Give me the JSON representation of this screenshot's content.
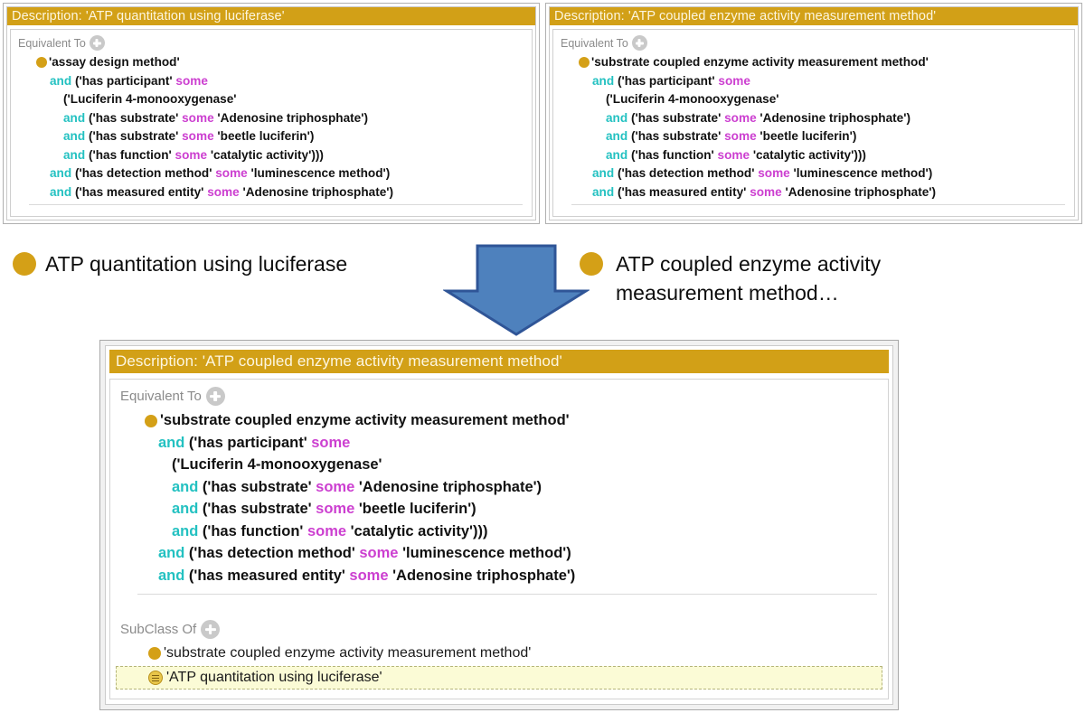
{
  "meta": {
    "colors": {
      "title_bar": "#d2a017",
      "and_keyword": "#23c1c1",
      "some_keyword": "#cc3fd0",
      "class_bullet": "#d4a017",
      "arrow_fill": "#4e81bd",
      "arrow_stroke": "#2f5597",
      "selection_background": "#fbfbd6"
    }
  },
  "panel_left": {
    "title": "Description: 'ATP quantitation using luciferase'",
    "section_label": "Equivalent To",
    "add_icon": "plus-icon",
    "root_class": "'assay design method'",
    "expression_lines": [
      {
        "indent": 0,
        "tokens": [
          {
            "t": "class",
            "v": "'assay design method'"
          }
        ]
      },
      {
        "indent": 1,
        "tokens": [
          {
            "t": "op",
            "v": "and"
          },
          {
            "t": "txt",
            "v": " ('has participant' "
          },
          {
            "t": "qnt",
            "v": "some"
          }
        ]
      },
      {
        "indent": 2,
        "tokens": [
          {
            "t": "txt",
            "v": "('Luciferin 4-monooxygenase'"
          }
        ]
      },
      {
        "indent": 2,
        "tokens": [
          {
            "t": "op",
            "v": "and"
          },
          {
            "t": "txt",
            "v": " ('has substrate' "
          },
          {
            "t": "qnt",
            "v": "some"
          },
          {
            "t": "txt",
            "v": " 'Adenosine triphosphate')"
          }
        ]
      },
      {
        "indent": 2,
        "tokens": [
          {
            "t": "op",
            "v": "and"
          },
          {
            "t": "txt",
            "v": " ('has substrate' "
          },
          {
            "t": "qnt",
            "v": "some"
          },
          {
            "t": "txt",
            "v": " 'beetle luciferin')"
          }
        ]
      },
      {
        "indent": 2,
        "tokens": [
          {
            "t": "op",
            "v": "and"
          },
          {
            "t": "txt",
            "v": " ('has function' "
          },
          {
            "t": "qnt",
            "v": "some"
          },
          {
            "t": "txt",
            "v": " 'catalytic activity')))"
          }
        ]
      },
      {
        "indent": 1,
        "tokens": [
          {
            "t": "op",
            "v": "and"
          },
          {
            "t": "txt",
            "v": " ('has detection method' "
          },
          {
            "t": "qnt",
            "v": "some"
          },
          {
            "t": "txt",
            "v": " 'luminescence method')"
          }
        ]
      },
      {
        "indent": 1,
        "tokens": [
          {
            "t": "op",
            "v": "and"
          },
          {
            "t": "txt",
            "v": " ('has measured entity' "
          },
          {
            "t": "qnt",
            "v": "some"
          },
          {
            "t": "txt",
            "v": " 'Adenosine triphosphate')"
          }
        ]
      }
    ]
  },
  "panel_right": {
    "title": "Description: 'ATP coupled enzyme activity measurement method'",
    "section_label": "Equivalent To",
    "add_icon": "plus-icon",
    "expression_lines": [
      {
        "indent": 0,
        "tokens": [
          {
            "t": "class",
            "v": "'substrate coupled enzyme activity measurement method'"
          }
        ]
      },
      {
        "indent": 1,
        "tokens": [
          {
            "t": "op",
            "v": "and"
          },
          {
            "t": "txt",
            "v": " ('has participant' "
          },
          {
            "t": "qnt",
            "v": "some"
          }
        ]
      },
      {
        "indent": 2,
        "tokens": [
          {
            "t": "txt",
            "v": "('Luciferin 4-monooxygenase'"
          }
        ]
      },
      {
        "indent": 2,
        "tokens": [
          {
            "t": "op",
            "v": "and"
          },
          {
            "t": "txt",
            "v": " ('has substrate' "
          },
          {
            "t": "qnt",
            "v": "some"
          },
          {
            "t": "txt",
            "v": " 'Adenosine triphosphate')"
          }
        ]
      },
      {
        "indent": 2,
        "tokens": [
          {
            "t": "op",
            "v": "and"
          },
          {
            "t": "txt",
            "v": " ('has substrate' "
          },
          {
            "t": "qnt",
            "v": "some"
          },
          {
            "t": "txt",
            "v": " 'beetle luciferin')"
          }
        ]
      },
      {
        "indent": 2,
        "tokens": [
          {
            "t": "op",
            "v": "and"
          },
          {
            "t": "txt",
            "v": " ('has function' "
          },
          {
            "t": "qnt",
            "v": "some"
          },
          {
            "t": "txt",
            "v": " 'catalytic activity')))"
          }
        ]
      },
      {
        "indent": 1,
        "tokens": [
          {
            "t": "op",
            "v": "and"
          },
          {
            "t": "txt",
            "v": " ('has detection method' "
          },
          {
            "t": "qnt",
            "v": "some"
          },
          {
            "t": "txt",
            "v": " 'luminescence method')"
          }
        ]
      },
      {
        "indent": 1,
        "tokens": [
          {
            "t": "op",
            "v": "and"
          },
          {
            "t": "txt",
            "v": " ('has measured entity' "
          },
          {
            "t": "qnt",
            "v": "some"
          },
          {
            "t": "txt",
            "v": " 'Adenosine triphosphate')"
          }
        ]
      }
    ]
  },
  "middle": {
    "left_label": "ATP quantitation using luciferase",
    "right_label_line1": "ATP coupled enzyme activity",
    "right_label_line2": "measurement method…",
    "arrow_icon": "down-arrow-icon"
  },
  "panel_bottom": {
    "title": "Description: 'ATP coupled enzyme activity measurement method'",
    "equivalent_to": {
      "section_label": "Equivalent To",
      "add_icon": "plus-icon",
      "expression_lines": [
        {
          "indent": 0,
          "tokens": [
            {
              "t": "class",
              "v": "'substrate coupled enzyme activity measurement method'"
            }
          ]
        },
        {
          "indent": 1,
          "tokens": [
            {
              "t": "op",
              "v": "and"
            },
            {
              "t": "txt",
              "v": " ('has participant' "
            },
            {
              "t": "qnt",
              "v": "some"
            }
          ]
        },
        {
          "indent": 2,
          "tokens": [
            {
              "t": "txt",
              "v": "('Luciferin 4-monooxygenase'"
            }
          ]
        },
        {
          "indent": 2,
          "tokens": [
            {
              "t": "op",
              "v": "and"
            },
            {
              "t": "txt",
              "v": " ('has substrate' "
            },
            {
              "t": "qnt",
              "v": "some"
            },
            {
              "t": "txt",
              "v": " 'Adenosine triphosphate')"
            }
          ]
        },
        {
          "indent": 2,
          "tokens": [
            {
              "t": "op",
              "v": "and"
            },
            {
              "t": "txt",
              "v": " ('has substrate' "
            },
            {
              "t": "qnt",
              "v": "some"
            },
            {
              "t": "txt",
              "v": " 'beetle luciferin')"
            }
          ]
        },
        {
          "indent": 2,
          "tokens": [
            {
              "t": "op",
              "v": "and"
            },
            {
              "t": "txt",
              "v": " ('has function' "
            },
            {
              "t": "qnt",
              "v": "some"
            },
            {
              "t": "txt",
              "v": " 'catalytic activity')))"
            }
          ]
        },
        {
          "indent": 1,
          "tokens": [
            {
              "t": "op",
              "v": "and"
            },
            {
              "t": "txt",
              "v": " ('has detection method' "
            },
            {
              "t": "qnt",
              "v": "some"
            },
            {
              "t": "txt",
              "v": " 'luminescence method')"
            }
          ]
        },
        {
          "indent": 1,
          "tokens": [
            {
              "t": "op",
              "v": "and"
            },
            {
              "t": "txt",
              "v": " ('has measured entity' "
            },
            {
              "t": "qnt",
              "v": "some"
            },
            {
              "t": "txt",
              "v": " 'Adenosine triphosphate')"
            }
          ]
        }
      ]
    },
    "subclass_of": {
      "section_label": "SubClass Of",
      "add_icon": "plus-icon",
      "rows": [
        {
          "icon": "class-bullet-icon",
          "label": "'substrate coupled enzyme activity measurement method'",
          "selected": false
        },
        {
          "icon": "defined-class-icon",
          "label": "'ATP quantitation using luciferase'",
          "selected": true
        }
      ]
    }
  }
}
